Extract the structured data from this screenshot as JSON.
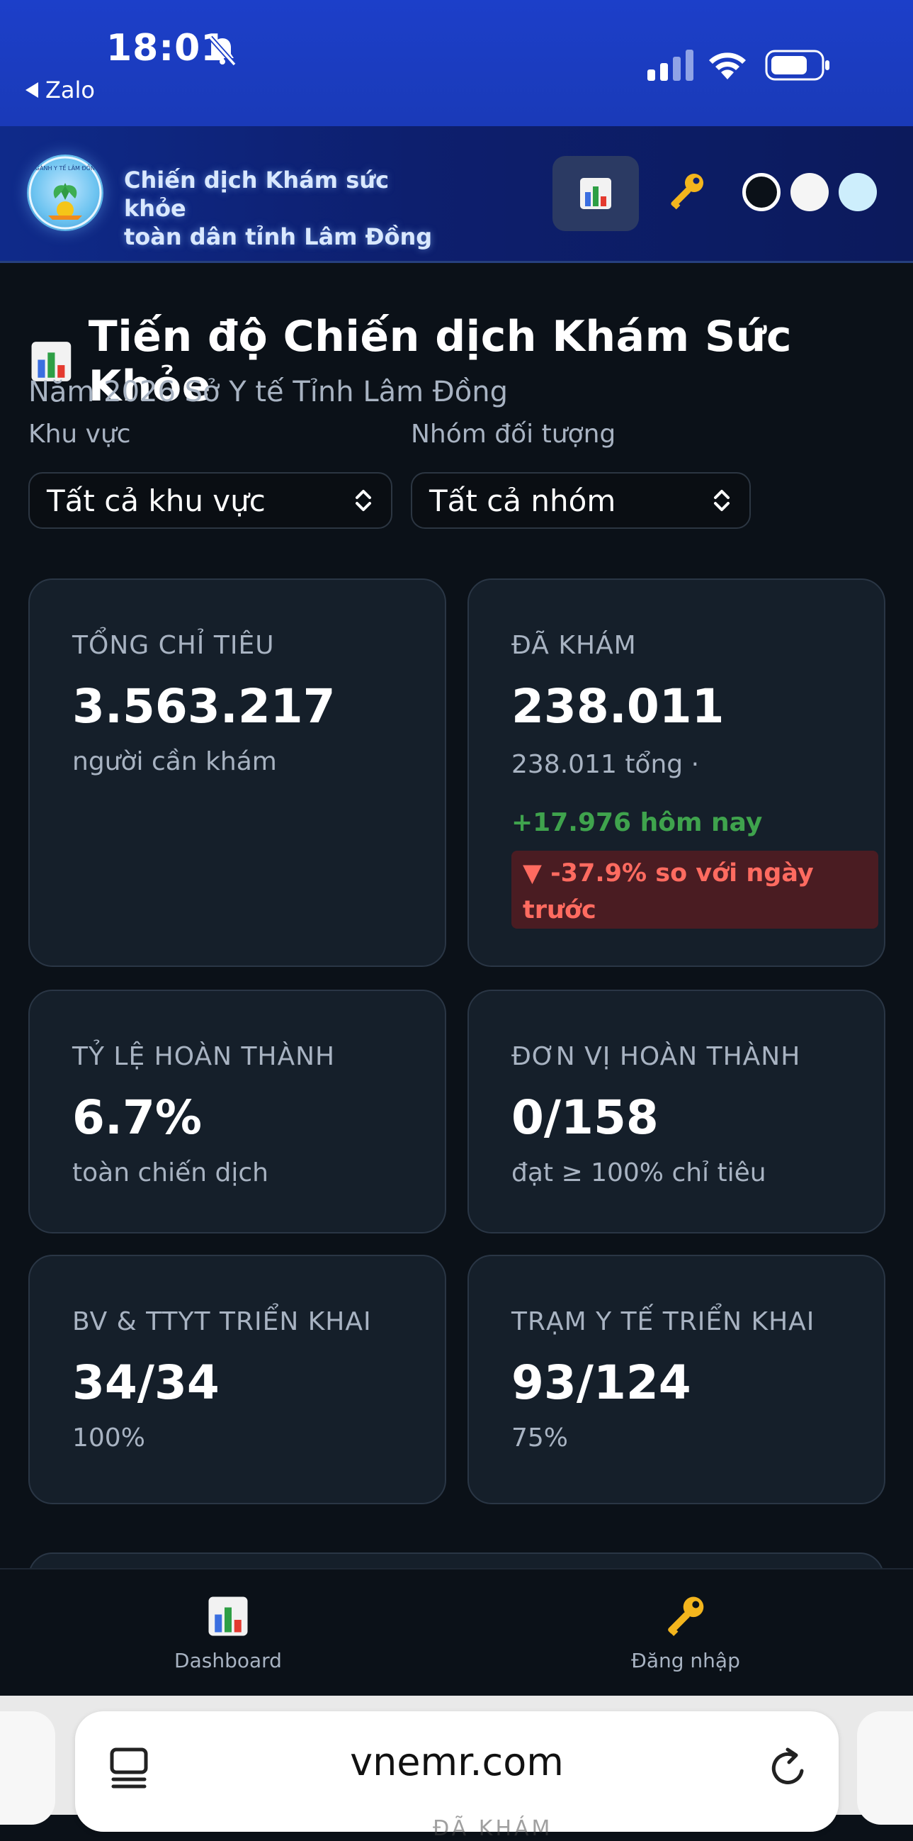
{
  "status_bar": {
    "time": "18:01",
    "back_app": "Zalo",
    "icons": [
      "bell-slash-icon",
      "signal-icon",
      "wifi-icon",
      "battery-icon"
    ]
  },
  "header": {
    "app_title_line1": "Chiến dịch Khám sức khỏe",
    "app_title_line2": "toàn dân tỉnh Lâm Đồng",
    "logo_text": "NGÀNH Y TẾ LÂM ĐỒNG",
    "icons": [
      "bar-chart-icon",
      "key-icon"
    ],
    "themes": [
      "dark",
      "light",
      "blue"
    ]
  },
  "main": {
    "title": "Tiến độ Chiến dịch Khám Sức Khỏe",
    "subtitle": "Năm 2026 Sở Y tế Tỉnh Lâm Đồng",
    "filters": {
      "region_label": "Khu vực",
      "region_value": "Tất cả khu vực",
      "group_label": "Nhóm đối tượng",
      "group_value": "Tất cả nhóm"
    },
    "cards": {
      "total": {
        "label": "TỔNG CHỈ TIÊU",
        "value": "3.563.217",
        "sub": "người cần khám"
      },
      "examined": {
        "label": "ĐÃ KHÁM",
        "value": "238.011",
        "sub": "238.011 tổng  ·",
        "today": "+17.976 hôm nay",
        "delta": "▼ -37.9% so với ngày trước"
      },
      "completion_rate": {
        "label": "TỶ LỆ HOÀN THÀNH",
        "value": "6.7%",
        "sub": "toàn chiến dịch"
      },
      "units_done": {
        "label": "ĐƠN VỊ HOÀN THÀNH",
        "value": "0/158",
        "sub": "đạt ≥ 100% chỉ tiêu"
      },
      "hospitals": {
        "label": "BV & TTYT TRIỂN KHAI",
        "value": "34/34",
        "sub": "100%"
      },
      "stations": {
        "label": "TRẠM Y TẾ TRIỂN KHAI",
        "value": "93/124",
        "sub": "75%"
      }
    }
  },
  "bottom_nav": {
    "items": [
      {
        "label": "Dashboard",
        "icon": "bar-chart-icon"
      },
      {
        "label": "Đăng nhập",
        "icon": "key-icon"
      }
    ]
  },
  "browser": {
    "url": "vnemr.com",
    "peek_text": "ĐÃ KHÁM"
  },
  "colors": {
    "status_bar_blue": "#1c3fc9",
    "page_bg": "#0b1118",
    "card_bg": "#151f2a",
    "positive_green": "#3fa34d",
    "negative_red": "#ff6b60"
  }
}
